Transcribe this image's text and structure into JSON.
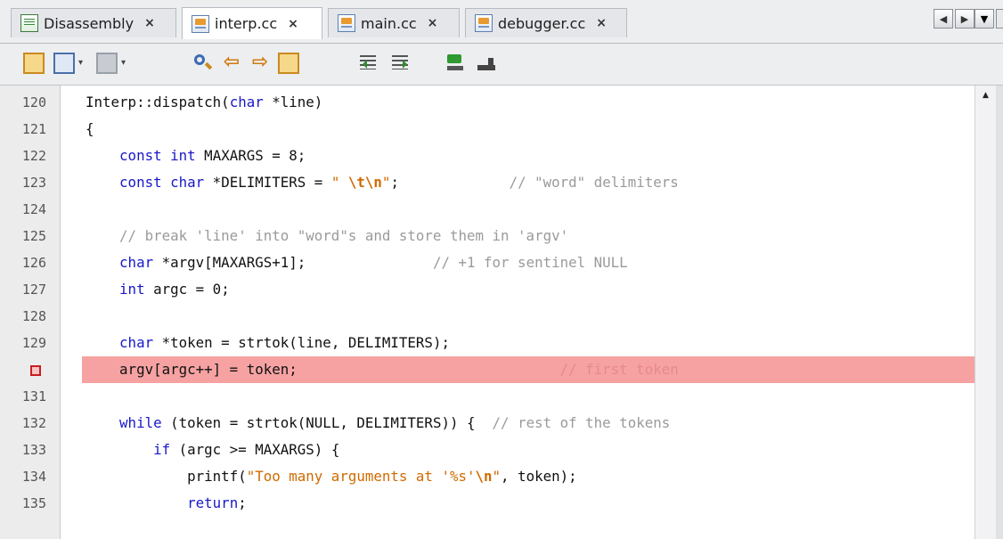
{
  "tabs": [
    {
      "label": "Disassembly",
      "close": "×",
      "icon": "disassembly-file-icon"
    },
    {
      "label": "interp.cc",
      "close": "×",
      "icon": "cc-file-icon",
      "active": true
    },
    {
      "label": "main.cc",
      "close": "×",
      "icon": "cc-file-icon"
    },
    {
      "label": "debugger.cc",
      "close": "×",
      "icon": "cc-file-icon"
    }
  ],
  "tab_nav": {
    "left": "◀",
    "right": "▶",
    "menu": "▼"
  },
  "toolbar": {
    "icons": [
      "back-to-last-edit-icon",
      "history-icon",
      "bookmark-icon",
      "find-icon",
      "find-previous-icon",
      "find-next-icon",
      "toggle-highlight-icon",
      "shift-left-icon",
      "shift-right-icon",
      "start-macro-icon",
      "stop-macro-icon"
    ],
    "dropdown_glyph": "▾"
  },
  "editor": {
    "scroll_up": "▲",
    "lines": [
      {
        "n": "120",
        "segments": [
          [
            "Interp::dispatch(",
            ""
          ],
          [
            "char",
            "kw"
          ],
          [
            " *line)",
            ""
          ]
        ]
      },
      {
        "n": "121",
        "segments": [
          [
            "{",
            ""
          ]
        ]
      },
      {
        "n": "122",
        "segments": [
          [
            "    ",
            ""
          ],
          [
            "const",
            "kw"
          ],
          [
            " ",
            ""
          ],
          [
            "int",
            "kw"
          ],
          [
            " MAXARGS = 8;",
            ""
          ]
        ]
      },
      {
        "n": "123",
        "segments": [
          [
            "    ",
            ""
          ],
          [
            "const",
            "kw"
          ],
          [
            " ",
            ""
          ],
          [
            "char",
            "kw"
          ],
          [
            " *DELIMITERS = ",
            ""
          ],
          [
            "\" ",
            "str"
          ],
          [
            "\\t\\n",
            "esc"
          ],
          [
            "\"",
            "str"
          ],
          [
            ";",
            ""
          ],
          [
            "             // \"word\" delimiters",
            "cm"
          ]
        ]
      },
      {
        "n": "124",
        "segments": [
          [
            "",
            ""
          ]
        ]
      },
      {
        "n": "125",
        "segments": [
          [
            "    ",
            ""
          ],
          [
            "// break 'line' into \"word\"s and store them in 'argv'",
            "cm"
          ]
        ]
      },
      {
        "n": "126",
        "segments": [
          [
            "    ",
            ""
          ],
          [
            "char",
            "kw"
          ],
          [
            " *argv[MAXARGS+1];",
            ""
          ],
          [
            "               // +1 for sentinel NULL",
            "cm"
          ]
        ]
      },
      {
        "n": "127",
        "segments": [
          [
            "    ",
            ""
          ],
          [
            "int",
            "kw"
          ],
          [
            " argc = 0;",
            ""
          ]
        ]
      },
      {
        "n": "128",
        "segments": [
          [
            "",
            ""
          ]
        ]
      },
      {
        "n": "129",
        "segments": [
          [
            "    ",
            ""
          ],
          [
            "char",
            "kw"
          ],
          [
            " *token = strtok(line, DELIMITERS);",
            ""
          ]
        ]
      },
      {
        "n": "",
        "breakpoint": true,
        "segments": [
          [
            "    argv[argc++] = token;",
            ""
          ],
          [
            "                               // first token",
            "cm bp"
          ]
        ]
      },
      {
        "n": "131",
        "segments": [
          [
            "",
            ""
          ]
        ]
      },
      {
        "n": "132",
        "segments": [
          [
            "    ",
            ""
          ],
          [
            "while",
            "kw"
          ],
          [
            " (token = strtok(NULL, DELIMITERS)) {  ",
            ""
          ],
          [
            "// rest of the tokens",
            "cm"
          ]
        ]
      },
      {
        "n": "133",
        "segments": [
          [
            "        ",
            ""
          ],
          [
            "if",
            "kw"
          ],
          [
            " (argc >= MAXARGS) {",
            ""
          ]
        ]
      },
      {
        "n": "134",
        "segments": [
          [
            "            printf(",
            ""
          ],
          [
            "\"Too many arguments at '%s'",
            "str"
          ],
          [
            "\\n",
            "esc"
          ],
          [
            "\"",
            "str"
          ],
          [
            ", token);",
            ""
          ]
        ]
      },
      {
        "n": "135",
        "segments": [
          [
            "            ",
            ""
          ],
          [
            "return",
            "kw"
          ],
          [
            ";",
            ""
          ]
        ]
      }
    ]
  }
}
